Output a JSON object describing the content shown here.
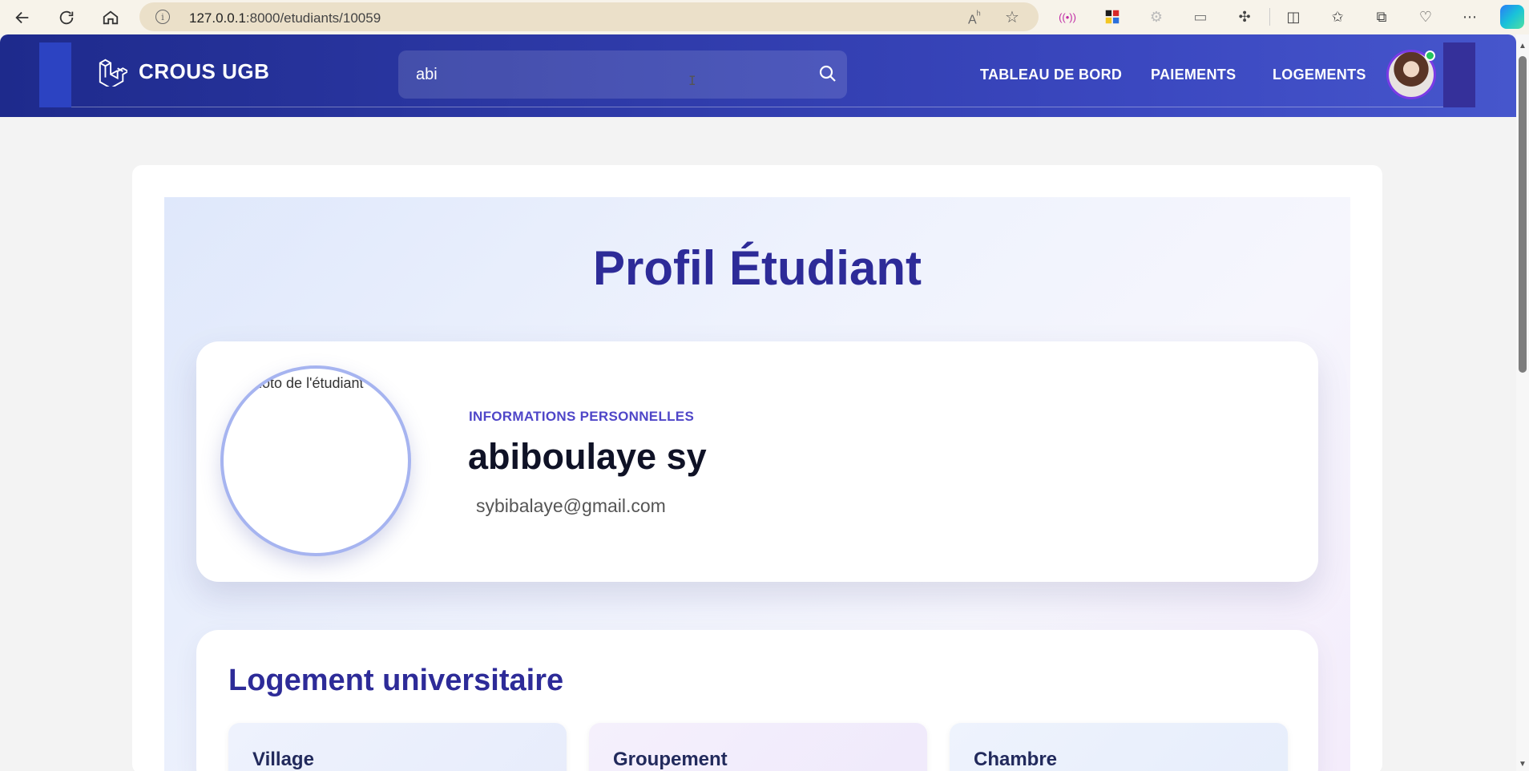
{
  "browser": {
    "url_host": "127.0.0.1",
    "url_path": ":8000/etudiants/10059"
  },
  "nav": {
    "brand": "CROUS UGB",
    "search_value": "abi",
    "links": [
      "TABLEAU DE BORD",
      "PAIEMENTS",
      "LOGEMENTS"
    ]
  },
  "profile": {
    "title": "Profil Étudiant",
    "photo_alt": "Photo de l'étudiant",
    "section_label": "INFORMATIONS PERSONNELLES",
    "name": "abiboulaye sy",
    "email": "sybibalaye@gmail.com"
  },
  "housing": {
    "title": "Logement universitaire",
    "items": [
      "Village",
      "Groupement",
      "Chambre"
    ]
  },
  "colors": {
    "nav_start": "#1e2a8c",
    "nav_end": "#4656cc",
    "title": "#2d2b98",
    "accent": "#4f46c8"
  }
}
